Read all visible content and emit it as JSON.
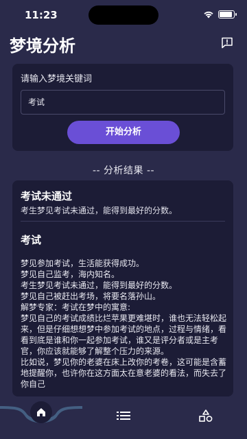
{
  "status": {
    "time": "11:23"
  },
  "header": {
    "title": "梦境分析",
    "feedback_icon": "message-alert-icon"
  },
  "search": {
    "label": "请输入梦境关键词",
    "value": "考试",
    "button_label": "开始分析"
  },
  "results": {
    "heading": "-- 分析结果 --",
    "items": [
      {
        "title": "考试未通过",
        "text": "考生梦见考试未通过，能得到最好的分数。"
      },
      {
        "title": "考试",
        "text": ""
      }
    ],
    "body": "梦见参加考试，生活能获得成功。\n梦见自己监考，海内知名。\n考生梦见考试未通过，能得到最好的分数。\n梦见自己被赶出考场，将要名落孙山。\n解梦专家：考试在梦中的寓意:\n梦见自己的考试成绩比烂苹果更难堪时，谁也无法轻松起来，但是仔细想想梦中参加考试的地点，过程与情绪，看看到底是谁和你一起参加考试，谁又是评分者或是主考官，你应该就能够了解整个压力的来源。\n比如说，梦见你的老婆在床上改你的考卷，这可能是含蓄地提醒你，也许你在这方面太在意老婆的看法，而失去了你自己"
  },
  "tabs": [
    {
      "name": "home",
      "icon": "home-icon",
      "active": true
    },
    {
      "name": "list",
      "icon": "list-icon",
      "active": false
    },
    {
      "name": "shapes",
      "icon": "shapes-icon",
      "active": false
    }
  ],
  "colors": {
    "background": "#2a2a4a",
    "card": "#1c1c36",
    "accent": "#6a4fd6"
  }
}
